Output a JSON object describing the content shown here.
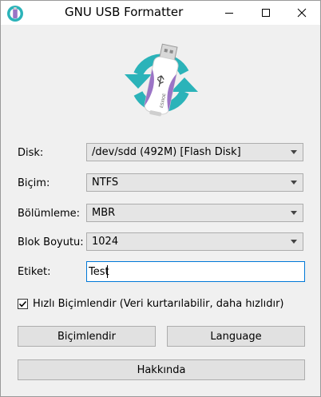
{
  "window": {
    "title": "GNU USB Formatter"
  },
  "form": {
    "disk": {
      "label": "Disk:",
      "value": "/dev/sdd (492M) [Flash Disk]"
    },
    "format": {
      "label": "Biçim:",
      "value": "NTFS"
    },
    "partition": {
      "label": "Bölümleme:",
      "value": "MBR"
    },
    "block_size": {
      "label": "Blok Boyutu:",
      "value": "1024"
    },
    "volume_label": {
      "label": "Etiket:",
      "value": "Test"
    },
    "quick_format": {
      "label": "Hızlı Biçimlendir (Veri kurtarılabilir, daha hızlıdır)",
      "checked": true
    }
  },
  "buttons": {
    "format": "Biçimlendir",
    "language": "Language",
    "about": "Hakkında"
  },
  "logo": {
    "device_text": "ESXIOE"
  },
  "icons": {
    "app": "usb-app-icon",
    "minimize": "minimize-icon",
    "maximize": "maximize-icon",
    "close": "close-icon",
    "dropdown": "chevron-down-icon",
    "check": "checkmark-icon"
  },
  "colors": {
    "teal": "#2bb3b9",
    "purple": "#9b74c6",
    "focus_border": "#0078d7",
    "title_bg": "#ffffff",
    "body_bg": "#f0f0f0"
  }
}
